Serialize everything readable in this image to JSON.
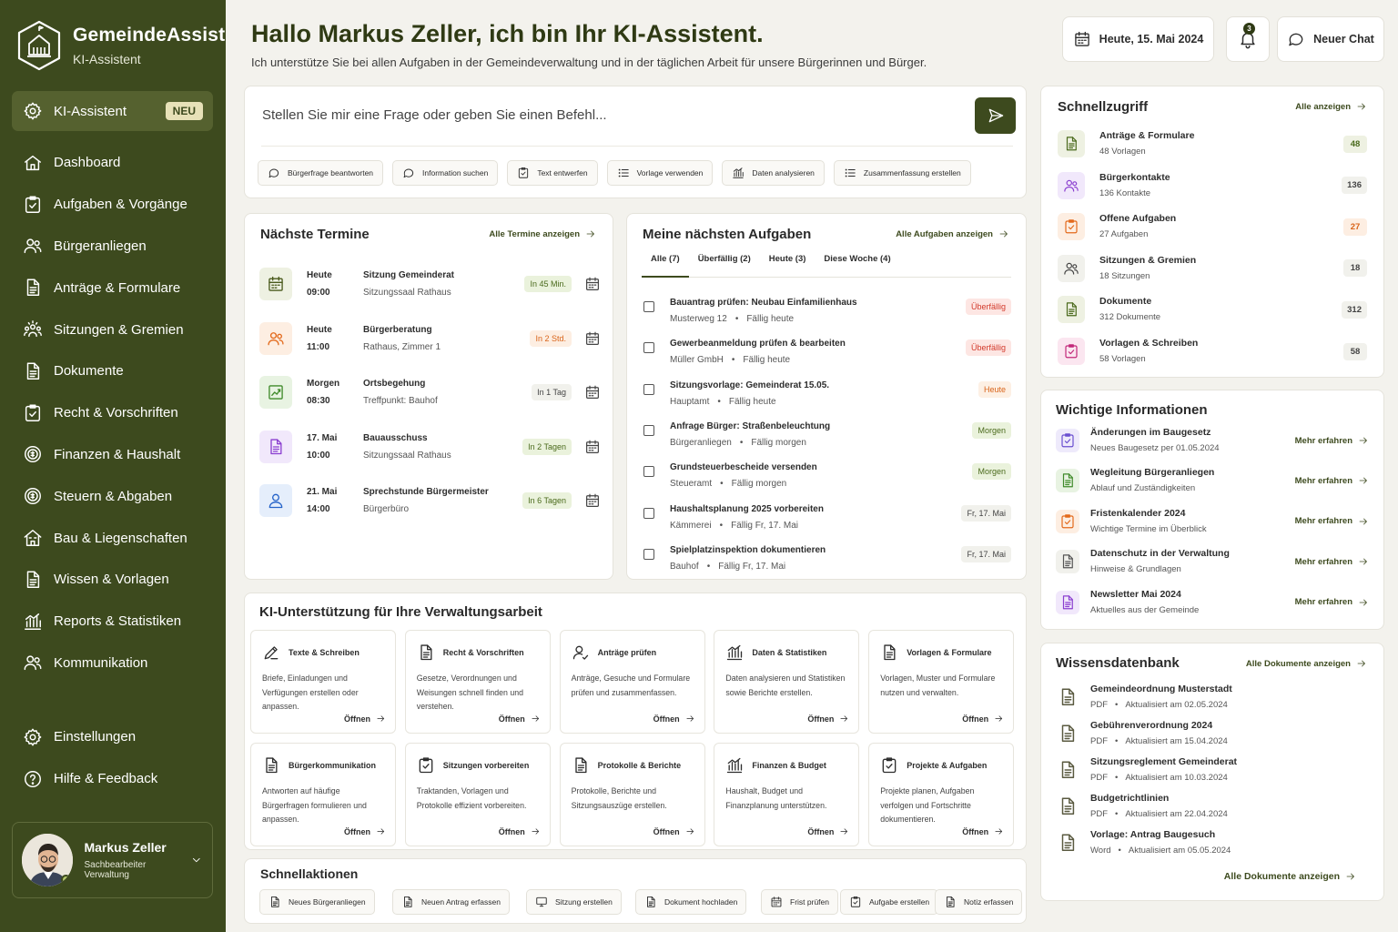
{
  "app": {
    "name": "GemeindeAssist",
    "subtitle": "KI-Assistent"
  },
  "sidebar": {
    "active": {
      "label": "KI-Assistent",
      "badge": "NEU",
      "icon": "gear-icon"
    },
    "items": [
      {
        "label": "Dashboard",
        "icon": "home-icon"
      },
      {
        "label": "Aufgaben & Vorgänge",
        "icon": "clipboard-check-icon"
      },
      {
        "label": "Bürgeranliegen",
        "icon": "users-icon"
      },
      {
        "label": "Anträge & Formulare",
        "icon": "document-icon"
      },
      {
        "label": "Sitzungen & Gremien",
        "icon": "meeting-icon"
      },
      {
        "label": "Dokumente",
        "icon": "document-icon"
      },
      {
        "label": "Recht & Vorschriften",
        "icon": "clipboard-check-icon"
      },
      {
        "label": "Finanzen & Haushalt",
        "icon": "coins-icon"
      },
      {
        "label": "Steuern & Abgaben",
        "icon": "coins-icon"
      },
      {
        "label": "Bau & Liegenschaften",
        "icon": "building-icon"
      },
      {
        "label": "Wissen & Vorlagen",
        "icon": "document-icon"
      },
      {
        "label": "Reports & Statistiken",
        "icon": "chart-icon"
      },
      {
        "label": "Kommunikation",
        "icon": "users-icon"
      }
    ],
    "bottom": [
      {
        "label": "Einstellungen",
        "icon": "gear-icon"
      },
      {
        "label": "Hilfe & Feedback",
        "icon": "help-icon"
      }
    ],
    "user": {
      "name": "Markus Zeller",
      "role": "Sachbearbeiter Verwaltung"
    }
  },
  "header": {
    "greeting": "Hallo Markus Zeller, ich bin Ihr KI-Assistent.",
    "subtitle": "Ich unterstütze Sie bei allen Aufgaben in der Gemeindeverwaltung und in der täglichen Arbeit für unsere Bürgerinnen und Bürger.",
    "date": "Heute, 15. Mai 2024",
    "notifications": "3",
    "new_chat": "Neuer Chat"
  },
  "prompt": {
    "placeholder": "Stellen Sie mir eine Frage oder geben Sie einen Befehl...",
    "chips": [
      {
        "label": "Bürgerfrage beantworten",
        "icon": "chat-icon"
      },
      {
        "label": "Information suchen",
        "icon": "chat-icon"
      },
      {
        "label": "Text entwerfen",
        "icon": "clipboard-check-icon"
      },
      {
        "label": "Vorlage verwenden",
        "icon": "list-icon"
      },
      {
        "label": "Daten analysieren",
        "icon": "chart-icon"
      },
      {
        "label": "Zusammenfassung erstellen",
        "icon": "list-icon"
      }
    ]
  },
  "termine": {
    "title": "Nächste Termine",
    "link": "Alle Termine anzeigen",
    "items": [
      {
        "day": "Heute",
        "time": "09:00",
        "title": "Sitzung Gemeinderat",
        "place": "Sitzungssaal Rathaus",
        "badge": "In 45 Min.",
        "icon": "calendar-icon",
        "color": "#4a5a1c",
        "bg": "#eef1e2",
        "badge_fg": "#4a6a1c",
        "badge_bg": "#eaf2dc"
      },
      {
        "day": "Heute",
        "time": "11:00",
        "title": "Bürgerberatung",
        "place": "Rathaus, Zimmer 1",
        "badge": "In 2 Std.",
        "icon": "users-icon",
        "color": "#e36a1c",
        "bg": "#fdeee2",
        "badge_fg": "#d9641a",
        "badge_bg": "#fdeee2"
      },
      {
        "day": "Morgen",
        "time": "08:30",
        "title": "Ortsbegehung",
        "place": "Treffpunkt: Bauhof",
        "badge": "In 1 Tag",
        "icon": "chart-line-icon",
        "color": "#3f8a2a",
        "bg": "#e8f3e2",
        "badge_fg": "#444",
        "badge_bg": "#f1f1ec"
      },
      {
        "day": "17. Mai",
        "time": "10:00",
        "title": "Bauausschuss",
        "place": "Sitzungssaal Rathaus",
        "badge": "In 2 Tagen",
        "icon": "document-icon",
        "color": "#8b3fd0",
        "bg": "#f1e8fb",
        "badge_fg": "#4a6a1c",
        "badge_bg": "#eaf2dc"
      },
      {
        "day": "21. Mai",
        "time": "14:00",
        "title": "Sprechstunde Bürgermeister",
        "place": "Bürgerbüro",
        "badge": "In 6 Tagen",
        "icon": "user-icon",
        "color": "#2563c9",
        "bg": "#e5eefb",
        "badge_fg": "#4a6a1c",
        "badge_bg": "#eaf2dc"
      }
    ]
  },
  "aufgaben": {
    "title": "Meine nächsten Aufgaben",
    "link": "Alle Aufgaben anzeigen",
    "tabs": [
      "Alle (7)",
      "Überfällig (2)",
      "Heute (3)",
      "Diese Woche (4)"
    ],
    "items": [
      {
        "title": "Bauantrag prüfen: Neubau Einfamilienhaus",
        "where": "Musterweg 12",
        "due": "Fällig heute",
        "badge": "Überfällig",
        "fg": "#d33a2c",
        "bg": "#fde6e3"
      },
      {
        "title": "Gewerbeanmeldung prüfen & bearbeiten",
        "where": "Müller GmbH",
        "due": "Fällig heute",
        "badge": "Überfällig",
        "fg": "#d33a2c",
        "bg": "#fde6e3"
      },
      {
        "title": "Sitzungsvorlage: Gemeinderat 15.05.",
        "where": "Hauptamt",
        "due": "Fällig heute",
        "badge": "Heute",
        "fg": "#d9641a",
        "bg": "#fdf0e4"
      },
      {
        "title": "Anfrage Bürger: Straßenbeleuchtung",
        "where": "Bürgeranliegen",
        "due": "Fällig morgen",
        "badge": "Morgen",
        "fg": "#4a6a1c",
        "bg": "#eaf2dc"
      },
      {
        "title": "Grundsteuerbescheide versenden",
        "where": "Steueramt",
        "due": "Fällig morgen",
        "badge": "Morgen",
        "fg": "#4a6a1c",
        "bg": "#eaf2dc"
      },
      {
        "title": "Haushaltsplanung 2025 vorbereiten",
        "where": "Kämmerei",
        "due": "Fällig Fr, 17. Mai",
        "badge": "Fr, 17. Mai",
        "fg": "#444",
        "bg": "#f1f1ec"
      },
      {
        "title": "Spielplatzinspektion dokumentieren",
        "where": "Bauhof",
        "due": "Fällig Fr, 17. Mai",
        "badge": "Fr, 17. Mai",
        "fg": "#444",
        "bg": "#f1f1ec"
      }
    ]
  },
  "ki": {
    "title": "KI-Unterstützung für Ihre Verwaltungsarbeit",
    "open_label": "Öffnen",
    "tiles": [
      {
        "title": "Texte & Schreiben",
        "text": "Briefe, Einladungen und Verfügungen erstellen oder anpassen.",
        "icon": "pen-icon"
      },
      {
        "title": "Recht & Vorschriften",
        "text": "Gesetze, Verordnungen und Weisungen schnell finden und verstehen.",
        "icon": "document-icon"
      },
      {
        "title": "Anträge prüfen",
        "text": "Anträge, Gesuche und Formulare prüfen und zusammenfassen.",
        "icon": "user-check-icon"
      },
      {
        "title": "Daten & Statistiken",
        "text": "Daten analysieren und Statistiken sowie Berichte erstellen.",
        "icon": "chart-icon"
      },
      {
        "title": "Vorlagen & Formulare",
        "text": "Vorlagen, Muster und Formulare nutzen und verwalten.",
        "icon": "document-icon"
      },
      {
        "title": "Bürgerkommunikation",
        "text": "Antworten auf häufige Bürgerfragen formulieren und anpassen.",
        "icon": "document-icon"
      },
      {
        "title": "Sitzungen vorbereiten",
        "text": "Traktanden, Vorlagen und Protokolle effizient vorbereiten.",
        "icon": "clipboard-check-icon"
      },
      {
        "title": "Protokolle & Berichte",
        "text": "Protokolle, Berichte und Sitzungsauszüge erstellen.",
        "icon": "document-icon"
      },
      {
        "title": "Finanzen & Budget",
        "text": "Haushalt, Budget und Finanzplanung unterstützen.",
        "icon": "chart-icon"
      },
      {
        "title": "Projekte & Aufgaben",
        "text": "Projekte planen, Aufgaben verfolgen und Fortschritte dokumentieren.",
        "icon": "clipboard-check-icon"
      }
    ]
  },
  "schnellaktionen": {
    "title": "Schnellaktionen",
    "items": [
      {
        "label": "Neues Bürgeranliegen",
        "icon": "document-icon"
      },
      {
        "label": "Neuen Antrag erfassen",
        "icon": "document-icon"
      },
      {
        "label": "Sitzung erstellen",
        "icon": "monitor-icon"
      },
      {
        "label": "Dokument hochladen",
        "icon": "document-icon"
      },
      {
        "label": "Frist prüfen",
        "icon": "calendar-icon"
      },
      {
        "label": "Aufgabe erstellen",
        "icon": "clipboard-check-icon"
      },
      {
        "label": "Notiz erfassen",
        "icon": "document-icon"
      }
    ]
  },
  "schnellzugriff": {
    "title": "Schnellzugriff",
    "link": "Alle anzeigen",
    "items": [
      {
        "title": "Anträge & Formulare",
        "sub": "48 Vorlagen",
        "count": "48",
        "icon": "document-icon",
        "color": "#4a6a1c",
        "bg": "#eef1e2",
        "cfg": "#4a6a1c",
        "cbg": "#eef1e2"
      },
      {
        "title": "Bürgerkontakte",
        "sub": "136 Kontakte",
        "count": "136",
        "icon": "users-icon",
        "color": "#8b3fd0",
        "bg": "#f1e8fb",
        "cfg": "#444",
        "cbg": "#f1f1ec"
      },
      {
        "title": "Offene Aufgaben",
        "sub": "27 Aufgaben",
        "count": "27",
        "icon": "clipboard-check-icon",
        "color": "#e36a1c",
        "bg": "#fdeee2",
        "cfg": "#d9641a",
        "cbg": "#fdeee2"
      },
      {
        "title": "Sitzungen & Gremien",
        "sub": "18 Sitzungen",
        "count": "18",
        "icon": "users-icon",
        "color": "#444",
        "bg": "#f1f1ec",
        "cfg": "#444",
        "cbg": "#f1f1ec"
      },
      {
        "title": "Dokumente",
        "sub": "312 Dokumente",
        "count": "312",
        "icon": "document-icon",
        "color": "#4a6a1c",
        "bg": "#eef1e2",
        "cfg": "#444",
        "cbg": "#f1f1ec"
      },
      {
        "title": "Vorlagen & Schreiben",
        "sub": "58 Vorlagen",
        "count": "58",
        "icon": "clipboard-check-icon",
        "color": "#c2287a",
        "bg": "#fbe6f0",
        "cfg": "#444",
        "cbg": "#f1f1ec"
      }
    ]
  },
  "infos": {
    "title": "Wichtige Informationen",
    "more": "Mehr erfahren",
    "items": [
      {
        "title": "Änderungen im Baugesetz",
        "sub": "Neues Baugesetz per 01.05.2024",
        "icon": "clipboard-check-icon",
        "color": "#6a4fd0",
        "bg": "#eeeafb"
      },
      {
        "title": "Wegleitung Bürgeranliegen",
        "sub": "Ablauf und Zuständigkeiten",
        "icon": "document-icon",
        "color": "#3f8a2a",
        "bg": "#e8f3e2"
      },
      {
        "title": "Fristenkalender 2024",
        "sub": "Wichtige Termine im Überblick",
        "icon": "clipboard-check-icon",
        "color": "#e36a1c",
        "bg": "#fdeee2"
      },
      {
        "title": "Datenschutz in der Verwaltung",
        "sub": "Hinweise & Grundlagen",
        "icon": "document-icon",
        "color": "#555",
        "bg": "#f1f1ec"
      },
      {
        "title": "Newsletter Mai 2024",
        "sub": "Aktuelles aus der Gemeinde",
        "icon": "document-icon",
        "color": "#8b3fd0",
        "bg": "#f1e8fb"
      }
    ]
  },
  "wissen": {
    "title": "Wissensdatenbank",
    "link": "Alle Dokumente anzeigen",
    "footer_link": "Alle Dokumente anzeigen",
    "items": [
      {
        "title": "Gemeindeordnung Musterstadt",
        "type": "PDF",
        "updated": "Aktualisiert am 02.05.2024"
      },
      {
        "title": "Gebührenverordnung 2024",
        "type": "PDF",
        "updated": "Aktualisiert am 15.04.2024"
      },
      {
        "title": "Sitzungsreglement Gemeinderat",
        "type": "PDF",
        "updated": "Aktualisiert am 10.03.2024"
      },
      {
        "title": "Budgetrichtlinien",
        "type": "PDF",
        "updated": "Aktualisiert am 22.04.2024"
      },
      {
        "title": "Vorlage: Antrag Baugesuch",
        "type": "Word",
        "updated": "Aktualisiert am 05.05.2024"
      }
    ]
  }
}
